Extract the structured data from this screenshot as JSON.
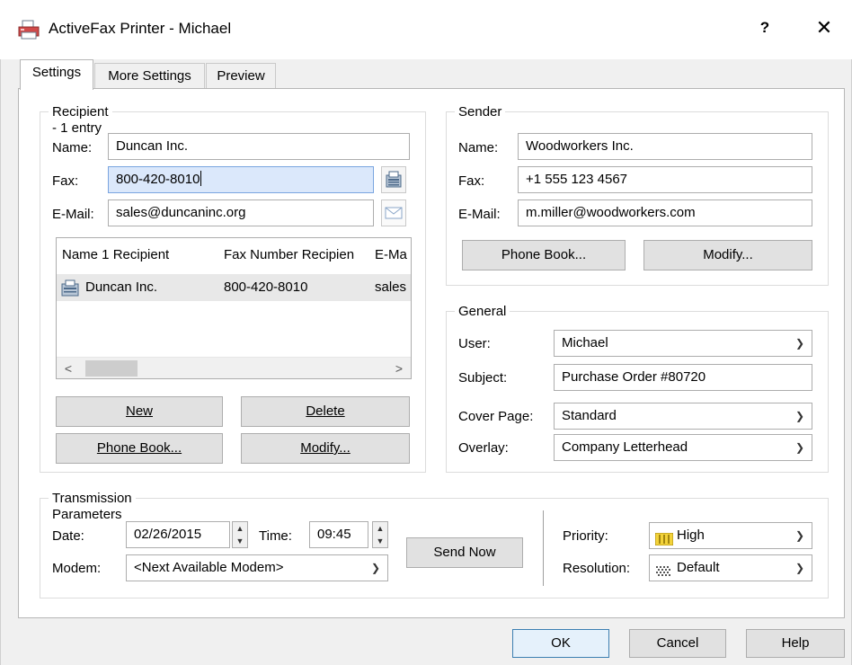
{
  "window": {
    "title": "ActiveFax Printer - Michael",
    "help_label": "?",
    "close_label": "✕"
  },
  "tabs": [
    {
      "label": "Settings"
    },
    {
      "label": "More Settings"
    },
    {
      "label": "Preview"
    }
  ],
  "recipient": {
    "legend": "Recipient - 1 entry",
    "name_label": "Name:",
    "name_value": "Duncan Inc.",
    "fax_label": "Fax:",
    "fax_value": "800-420-8010",
    "email_label": "E-Mail:",
    "email_value": "sales@duncaninc.org",
    "list": {
      "columns": [
        "Name 1 Recipient",
        "Fax Number Recipien",
        "E-Ma"
      ],
      "rows": [
        {
          "name": "Duncan Inc.",
          "fax": "800-420-8010",
          "email": "sales"
        }
      ]
    },
    "new_label": "New",
    "delete_label": "Delete",
    "phonebook_label": "Phone Book...",
    "modify_label": "Modify..."
  },
  "sender": {
    "legend": "Sender",
    "name_label": "Name:",
    "name_value": "Woodworkers Inc.",
    "fax_label": "Fax:",
    "fax_value": "+1 555 123 4567",
    "email_label": "E-Mail:",
    "email_value": "m.miller@woodworkers.com",
    "phonebook_label": "Phone Book...",
    "modify_label": "Modify..."
  },
  "general": {
    "legend": "General",
    "user_label": "User:",
    "user_value": "Michael",
    "subject_label": "Subject:",
    "subject_value": "Purchase Order #80720",
    "cover_label": "Cover Page:",
    "cover_value": "Standard",
    "overlay_label": "Overlay:",
    "overlay_value": "Company Letterhead"
  },
  "transmission": {
    "legend": "Transmission Parameters",
    "date_label": "Date:",
    "date_value": "02/26/2015",
    "time_label": "Time:",
    "time_value": "09:45",
    "modem_label": "Modem:",
    "modem_value": "<Next Available Modem>",
    "send_now_label": "Send Now",
    "priority_label": "Priority:",
    "priority_value": "High",
    "resolution_label": "Resolution:",
    "resolution_value": "Default"
  },
  "footer": {
    "ok_label": "OK",
    "cancel_label": "Cancel",
    "help_label": "Help"
  },
  "colors": {
    "focus_fill": "#dbe8fb",
    "default_button_border": "#3c7fb1",
    "priority_icon": "#e8c21a"
  }
}
